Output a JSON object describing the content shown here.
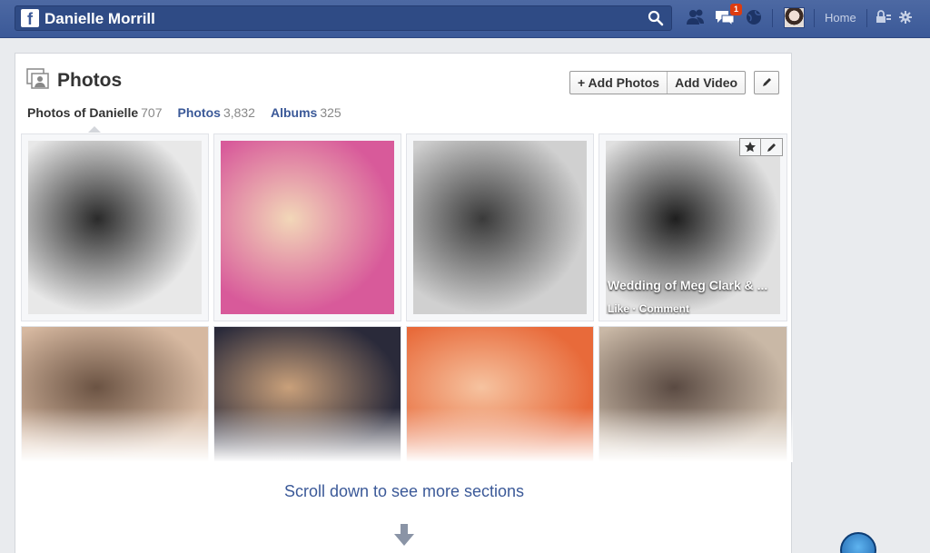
{
  "topbar": {
    "logo": "f",
    "search_value": "Danielle Morrill",
    "notification_count": "1",
    "home_label": "Home",
    "icons": [
      "friend-requests-icon",
      "messages-icon",
      "notifications-globe-icon",
      "privacy-lock-icon",
      "settings-gear-icon"
    ]
  },
  "header": {
    "title": "Photos",
    "add_photos_label": "+ Add Photos",
    "add_video_label": "Add Video"
  },
  "tabs": [
    {
      "label": "Photos of Danielle",
      "count": "707"
    },
    {
      "label": "Photos",
      "count": "3,832"
    },
    {
      "label": "Albums",
      "count": "325"
    }
  ],
  "photos": [
    {
      "colors": [
        "#e8e8e8",
        "#2a2a2a"
      ]
    },
    {
      "colors": [
        "#d85a9a",
        "#f2d7b8"
      ]
    },
    {
      "colors": [
        "#d0d0d0",
        "#3a3a3a"
      ]
    },
    {
      "colors": [
        "#e0e0e0",
        "#1e1e1e"
      ],
      "caption": "Wedding of Meg Clark & ...",
      "actions": "Like · Comment"
    },
    {
      "colors": [
        "#d6b8a0",
        "#6b5343"
      ]
    },
    {
      "colors": [
        "#2a2a3a",
        "#c9a07a"
      ]
    },
    {
      "colors": [
        "#e86a3a",
        "#f6c3a0"
      ]
    },
    {
      "colors": [
        "#c9b8a6",
        "#5a4a42"
      ]
    }
  ],
  "scroll_message": "Scroll down to see more sections",
  "colors": {
    "brand": "#3b5998",
    "link": "#3b5998"
  }
}
